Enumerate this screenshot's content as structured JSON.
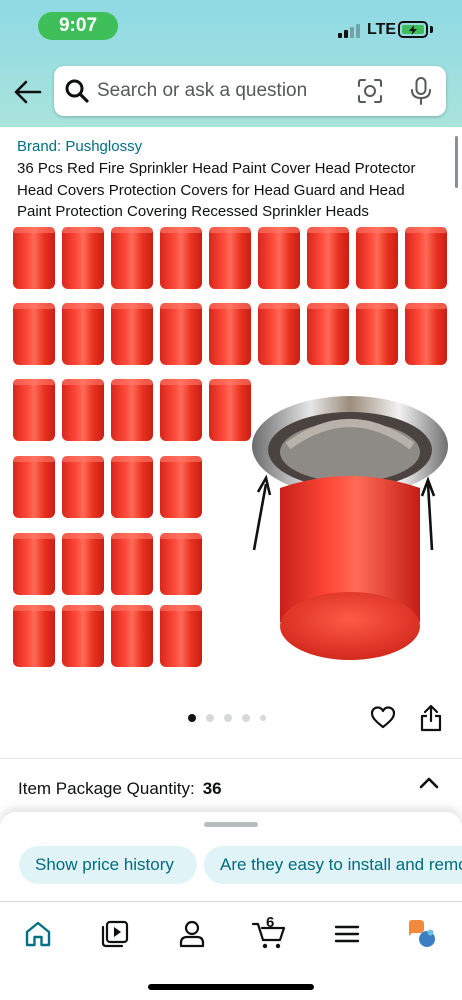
{
  "status_bar": {
    "time": "9:07",
    "network": "LTE"
  },
  "search": {
    "placeholder": "Search or ask a question"
  },
  "product": {
    "brand": "Brand: Pushglossy",
    "title": "36 Pcs Red Fire Sprinkler Head Paint Cover Head Protector Head Covers Protection Covers for Head Guard and Head Paint Protection Covering Recessed Sprinkler Heads",
    "image_count": 5,
    "active_image": 1,
    "cap_count": 36
  },
  "options": {
    "quantity_label": "Item Package Quantity:",
    "quantity_value": "36"
  },
  "chips": [
    "Show price history",
    "Are they easy to install and remove?"
  ],
  "tabbar": {
    "cart_count": "6"
  },
  "colors": {
    "accent": "#007185",
    "cap_red": "#f03a2a",
    "chip_bg": "#e0f4f8"
  }
}
